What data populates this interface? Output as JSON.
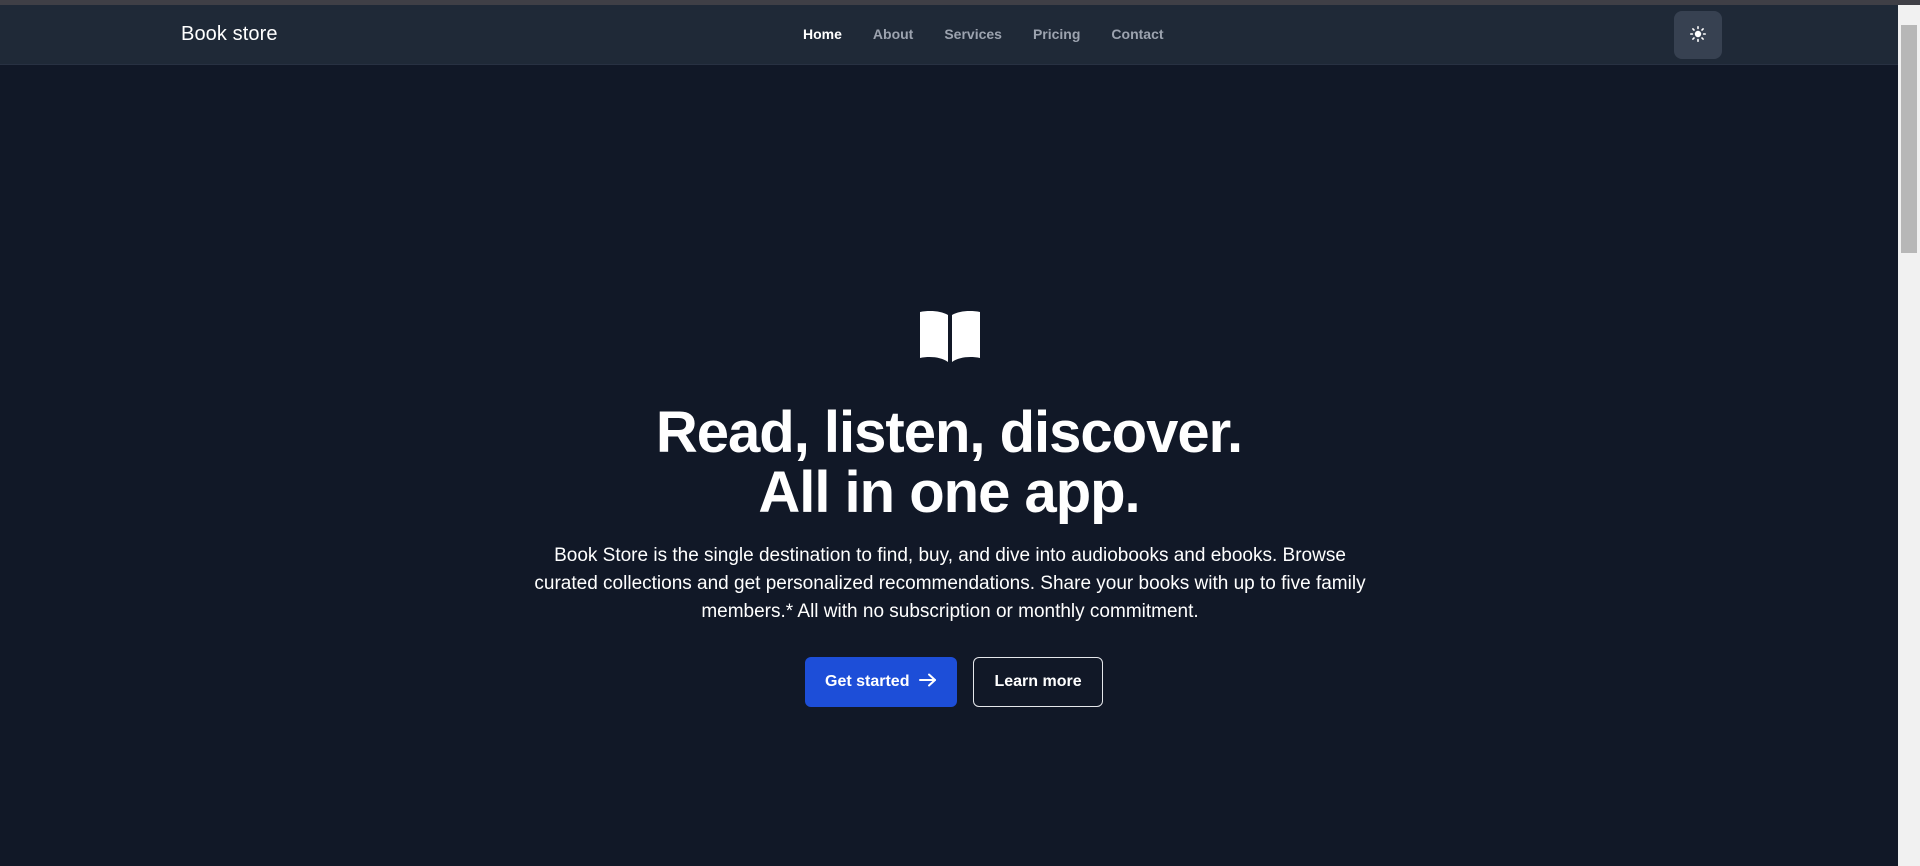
{
  "header": {
    "brand": "Book store",
    "nav": [
      {
        "label": "Home",
        "active": true
      },
      {
        "label": "About",
        "active": false
      },
      {
        "label": "Services",
        "active": false
      },
      {
        "label": "Pricing",
        "active": false
      },
      {
        "label": "Contact",
        "active": false
      }
    ],
    "theme_toggle_icon": "sun-icon"
  },
  "hero": {
    "icon": "open-book-icon",
    "headline_line1": "Read, listen, discover.",
    "headline_line2": "All in one app.",
    "description": "Book Store is the single destination to find, buy, and dive into audiobooks and ebooks. Browse curated collections and get personalized recommendations. Share your books with up to five family members.* All with no subscription or monthly commitment.",
    "primary_button": "Get started",
    "primary_button_icon": "arrow-right-icon",
    "secondary_button": "Learn more"
  },
  "colors": {
    "background": "#111827",
    "navbar": "#1f2937",
    "accent": "#1d4ed8",
    "text": "#ffffff",
    "nav_inactive": "#9ca3af"
  }
}
